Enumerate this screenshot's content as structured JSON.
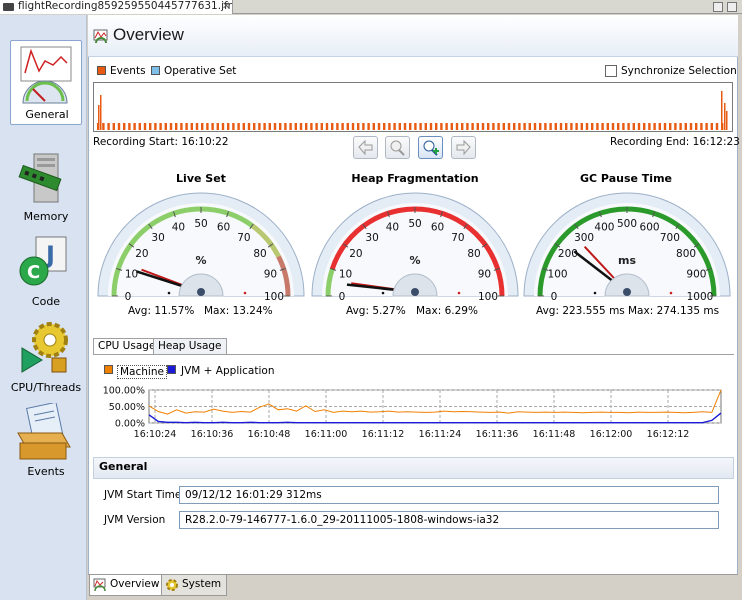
{
  "editor_tab": {
    "label": "flightRecording859259550445777631.jfr",
    "close": "✕"
  },
  "nav": [
    {
      "label": "General"
    },
    {
      "label": "Memory"
    },
    {
      "label": "Code"
    },
    {
      "label": "CPU/Threads"
    },
    {
      "label": "Events"
    }
  ],
  "page_title": "Overview",
  "timeline": {
    "legend_events": "Events",
    "legend_operative": "Operative Set",
    "sync_label": "Synchronize Selection",
    "start": "Recording Start: 16:10:22",
    "end": "Recording End: 16:12:23",
    "colors": {
      "events": "#e85a12",
      "operative": "#7fc0e8"
    }
  },
  "gauges": [
    {
      "title": "Live Set",
      "unit": "%",
      "ticks": [
        "0",
        "10",
        "20",
        "30",
        "40",
        "50",
        "60",
        "70",
        "80",
        "90",
        "100"
      ],
      "avg_text": "Avg: 11.57%",
      "max_text": "Max: 13.24%",
      "max": 100,
      "avg_value": 11.57,
      "max_value": 13.24
    },
    {
      "title": "Heap Fragmentation",
      "unit": "%",
      "ticks": [
        "0",
        "10",
        "20",
        "30",
        "40",
        "50",
        "60",
        "70",
        "80",
        "90",
        "100"
      ],
      "avg_text": "Avg: 5.27%",
      "max_text": "Max: 6.29%",
      "max": 100,
      "avg_value": 5.27,
      "max_value": 6.29
    },
    {
      "title": "GC Pause Time",
      "unit": "ms",
      "ticks": [
        "0",
        "100",
        "200",
        "300",
        "400",
        "500",
        "600",
        "700",
        "800",
        "900",
        "1000"
      ],
      "avg_text": "Avg: 223.555 ms",
      "max_text": "Max: 274.135 ms",
      "max": 1000,
      "avg_value": 223.555,
      "max_value": 274.135
    }
  ],
  "cpu_tabs": [
    "CPU Usage",
    "Heap Usage"
  ],
  "cpu_chart": {
    "legend_machine": "Machine",
    "legend_jvm": "JVM + Application",
    "colors": {
      "machine": "#f08000",
      "jvm": "#1a1ad8"
    }
  },
  "chart_data": {
    "type": "line",
    "ylim": [
      0,
      100
    ],
    "y_ticks": [
      "100.00%",
      "50.00%",
      "0.00%"
    ],
    "x_ticks": [
      "16:10:24",
      "16:10:36",
      "16:10:48",
      "16:11:00",
      "16:11:12",
      "16:11:24",
      "16:11:36",
      "16:11:48",
      "16:12:00",
      "16:12:12"
    ],
    "series": [
      {
        "name": "Machine",
        "values": [
          52,
          35,
          27,
          40,
          30,
          34,
          33,
          42,
          36,
          32,
          35,
          33,
          48,
          58,
          40,
          43,
          36,
          52,
          35,
          40,
          32,
          36,
          34,
          36,
          33,
          34,
          36,
          33,
          34,
          33,
          32,
          33,
          36,
          34,
          35,
          34,
          33,
          32,
          33,
          30,
          34,
          33,
          32,
          33,
          32,
          33,
          32,
          31,
          32,
          33,
          32,
          32,
          31,
          33,
          32,
          32,
          33,
          32,
          31,
          32,
          34,
          32,
          100
        ]
      },
      {
        "name": "JVM + Application",
        "values": [
          25,
          5,
          2,
          2,
          1,
          2,
          1,
          1,
          2,
          1,
          1,
          2,
          1,
          1,
          1,
          2,
          1,
          1,
          1,
          1,
          1,
          1,
          1,
          1,
          1,
          1,
          1,
          1,
          1,
          1,
          1,
          1,
          1,
          1,
          1,
          1,
          1,
          1,
          1,
          1,
          1,
          1,
          1,
          1,
          1,
          1,
          1,
          1,
          1,
          1,
          1,
          1,
          1,
          1,
          1,
          1,
          1,
          1,
          1,
          1,
          1,
          8,
          30
        ]
      }
    ]
  },
  "general": {
    "title": "General",
    "jvm_start_label": "JVM Start Time",
    "jvm_start_value": "09/12/12 16:01:29 312ms",
    "jvm_version_label": "JVM Version",
    "jvm_version_value": "R28.2.0-79-146777-1.6.0_29-20111005-1808-windows-ia32"
  },
  "bottom_tabs": [
    "Overview",
    "System"
  ]
}
